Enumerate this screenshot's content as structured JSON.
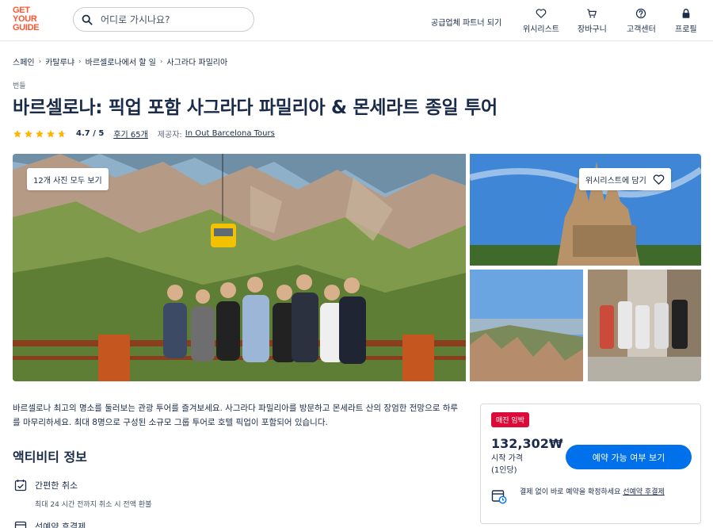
{
  "header": {
    "logo_line1": "GET",
    "logo_line2": "YOUR",
    "logo_line3": "GUIDE",
    "search_placeholder": "어디로 가시나요?",
    "partner_link": "공급업체 파트너 되기",
    "nav": [
      {
        "label": "위시리스트",
        "icon": "heart-icon"
      },
      {
        "label": "장바구니",
        "icon": "cart-icon"
      },
      {
        "label": "고객센터",
        "icon": "help-icon"
      },
      {
        "label": "프로필",
        "icon": "lock-icon"
      }
    ]
  },
  "breadcrumb": [
    "스페인",
    "카탈루냐",
    "바르셀로나에서 할 일",
    "사그라다 파밀리아"
  ],
  "category": "번들",
  "title": "바르셀로나: 픽업 포함 사그라다 파밀리아 & 몬세라트 종일 투어",
  "rating": {
    "stars": 4.7,
    "score_text": "4.7 / 5",
    "reviews_text": "후기 65개",
    "provider_label": "제공자:",
    "provider_name": "In Out Barcelona Tours"
  },
  "gallery": {
    "all_photos_label": "12개 사진 모두 보기",
    "wishlist_label": "위시리스트에 담기"
  },
  "description": "바르셀로나 최고의 명소를 둘러보는 관광 투어를 즐겨보세요. 사그라다 파밀리아를 방문하고 몬세라트 산의 장엄한 전망으로 하루를 마무리하세요. 최대 8명으로 구성된 소규모 그룹 투어로 호텔 픽업이 포함되어 있습니다.",
  "activity_info": {
    "title": "액티비티 정보",
    "features": [
      {
        "title": "간편한 취소",
        "subtitle": "최대 24 시간 전까지 취소 시 전액 환불",
        "icon": "calendar-check-icon"
      },
      {
        "title": "선예약 후결제",
        "subtitle": "",
        "icon": "calendar-icon"
      }
    ]
  },
  "booking": {
    "badge": "매진 임박",
    "price": "132,302₩",
    "price_label": "시작 가격",
    "price_unit": "(1인당)",
    "cta": "예약 가능 여부 보기",
    "reserve_text": "결제 없이 바로 예약을 확정하세요 ",
    "reserve_link": "선예약 후결제"
  },
  "colors": {
    "brand": "#ff5533",
    "primary_button": "#0071eb",
    "badge": "#dc0a38",
    "text": "#1a2b49",
    "star": "#ffb400"
  }
}
